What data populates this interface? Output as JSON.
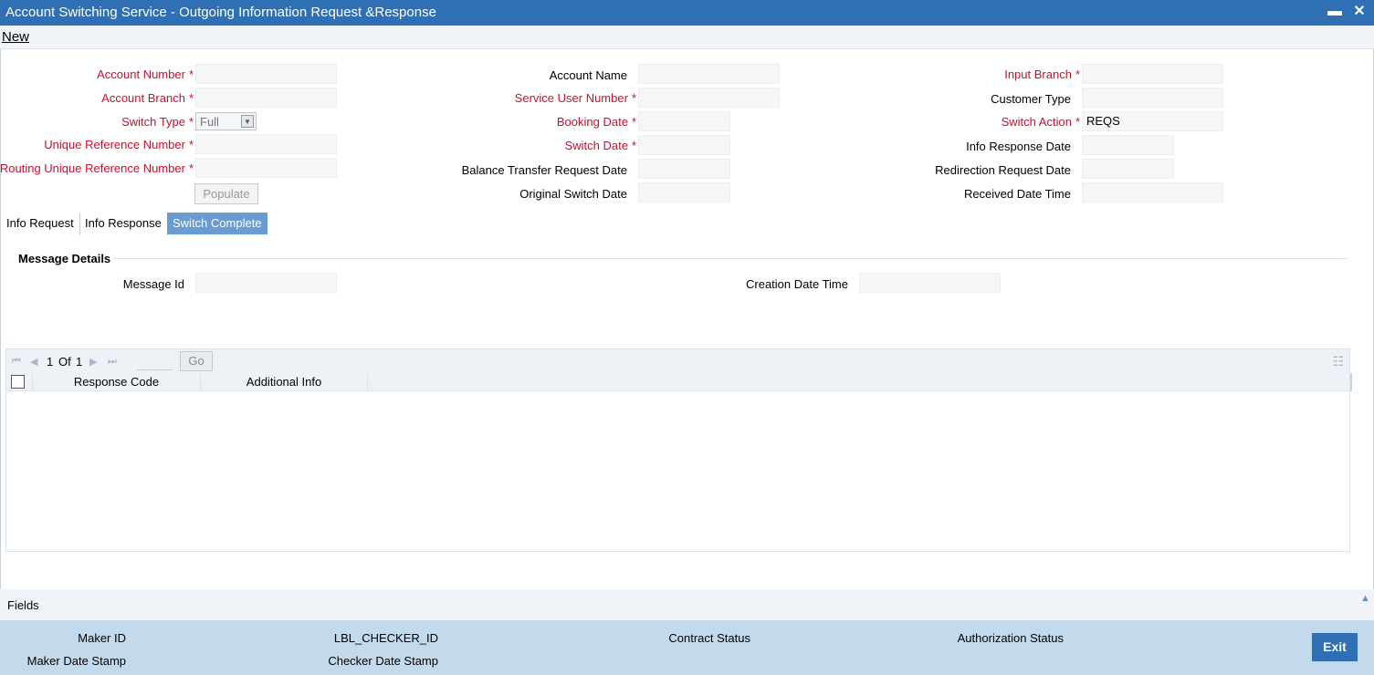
{
  "window": {
    "title": "Account Switching Service - Outgoing Information Request &Response",
    "minimize": "▬",
    "close": "✕"
  },
  "menu": {
    "new": "New"
  },
  "form": {
    "account_number": "Account Number",
    "account_branch": "Account Branch",
    "switch_type": "Switch Type",
    "switch_type_value": "Full",
    "unique_reference_number": "Unique Reference Number",
    "routing_unique_reference_number": "Routing Unique Reference Number",
    "populate": "Populate",
    "account_name": "Account Name",
    "service_user_number": "Service User Number",
    "booking_date": "Booking Date",
    "switch_date": "Switch Date",
    "balance_transfer_request_date": "Balance Transfer Request Date",
    "original_switch_date": "Original Switch Date",
    "input_branch": "Input Branch",
    "customer_type": "Customer Type",
    "switch_action": "Switch Action",
    "switch_action_value": "REQS",
    "info_response_date": "Info Response Date",
    "redirection_request_date": "Redirection Request Date",
    "received_date_time": "Received Date Time",
    "required_mark": "*"
  },
  "tabs": [
    {
      "label": "Info Request"
    },
    {
      "label": "Info Response"
    },
    {
      "label": "Switch Complete"
    }
  ],
  "message_details": {
    "title": "Message Details",
    "message_id": "Message Id",
    "creation_date_time": "Creation Date Time"
  },
  "grid": {
    "page_current": "1",
    "page_of": "Of",
    "page_total": "1",
    "go": "Go",
    "columns": [
      "Response Code",
      "Additional Info"
    ]
  },
  "fields_bar": {
    "label": "Fields"
  },
  "footer": {
    "maker_id": "Maker ID",
    "maker_date_stamp": "Maker Date Stamp",
    "checker_id": "LBL_CHECKER_ID",
    "checker_date_stamp": "Checker Date Stamp",
    "contract_status": "Contract Status",
    "authorization_status": "Authorization Status",
    "exit": "Exit"
  }
}
